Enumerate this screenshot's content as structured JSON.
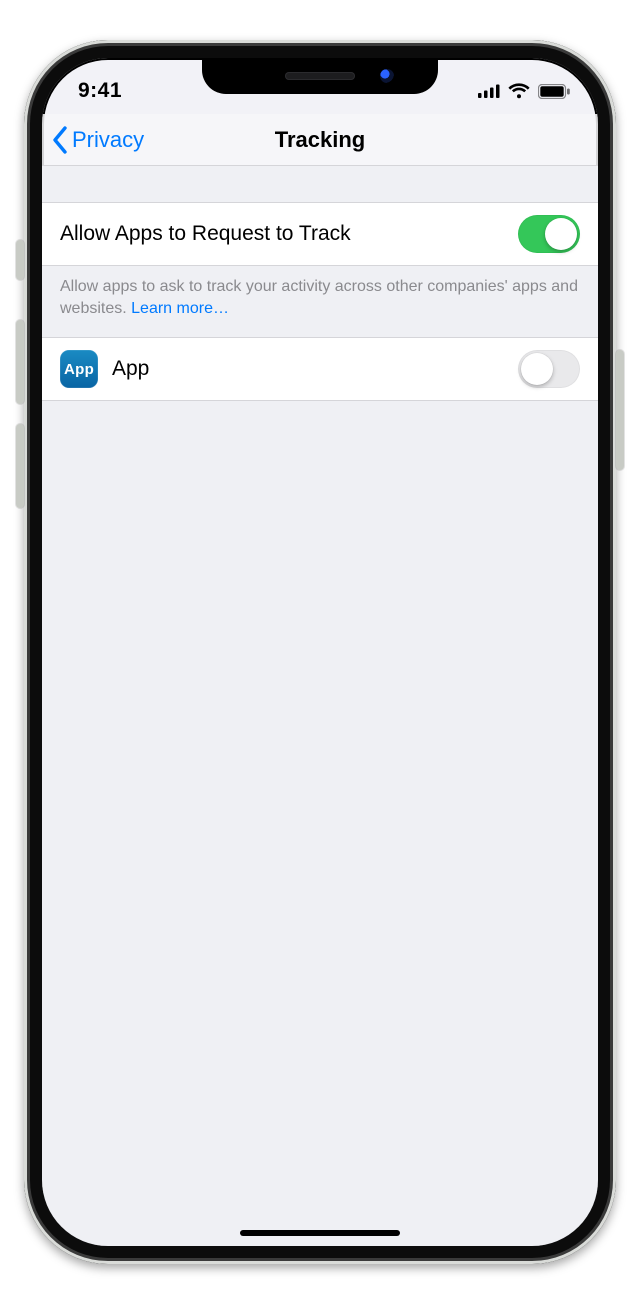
{
  "statusbar": {
    "time": "9:41"
  },
  "nav": {
    "back_label": "Privacy",
    "title": "Tracking"
  },
  "main_toggle": {
    "label": "Allow Apps to Request to Track",
    "on": true
  },
  "footer": {
    "text": "Allow apps to ask to track your activity across other companies' apps and websites. ",
    "learn_more": "Learn more…"
  },
  "apps": [
    {
      "icon_label": "App",
      "name": "App",
      "on": false
    }
  ]
}
